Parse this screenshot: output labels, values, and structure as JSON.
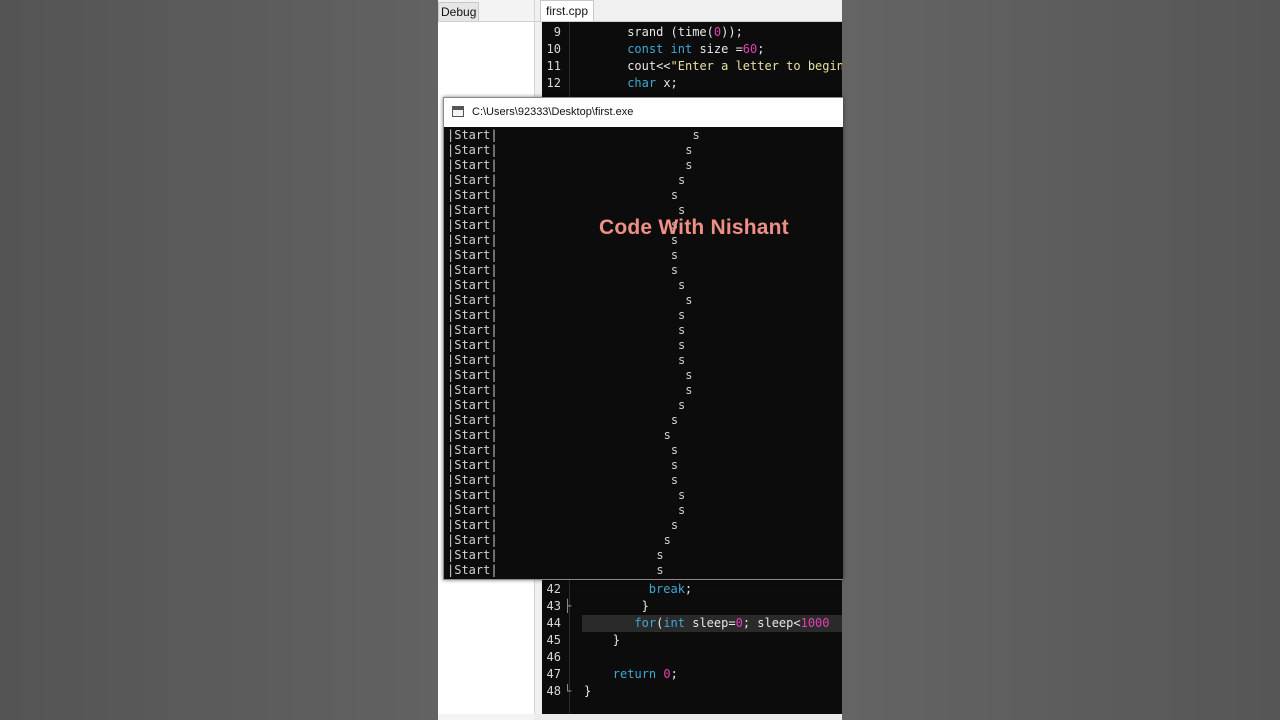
{
  "ide": {
    "panel_tab_label": "Debug",
    "file_tab_label": "first.cpp"
  },
  "editor": {
    "top_lines": [
      {
        "line": "9",
        "tokens": [
          [
            "",
            "srand (time("
          ],
          [
            "num",
            "0"
          ],
          [
            "",
            "));"
          ]
        ]
      },
      {
        "line": "10",
        "tokens": [
          [
            "kw",
            "const int"
          ],
          [
            "",
            " size ="
          ],
          [
            "num",
            "60"
          ],
          [
            "",
            ";"
          ]
        ]
      },
      {
        "line": "11",
        "tokens": [
          [
            "",
            "cout<<"
          ],
          [
            "str",
            "\"Enter a letter to begin"
          ]
        ]
      },
      {
        "line": "12",
        "tokens": [
          [
            "kw",
            "char"
          ],
          [
            "",
            " x;"
          ]
        ]
      }
    ],
    "bottom_lines": [
      {
        "line": "42",
        "tokens": [
          [
            "kw",
            "break"
          ],
          [
            "",
            ";"
          ]
        ]
      },
      {
        "line": "43",
        "tokens": [
          [
            "",
            "}"
          ]
        ]
      },
      {
        "line": "44",
        "tokens": [
          [
            "kw",
            "for"
          ],
          [
            "",
            "("
          ],
          [
            "kw",
            "int"
          ],
          [
            "",
            " sleep="
          ],
          [
            "num",
            "0"
          ],
          [
            "",
            "; sleep<"
          ],
          [
            "num",
            "1000"
          ]
        ]
      },
      {
        "line": "45",
        "tokens": [
          [
            "",
            "}"
          ]
        ]
      },
      {
        "line": "46",
        "tokens": []
      },
      {
        "line": "47",
        "tokens": [
          [
            "kw",
            "return"
          ],
          [
            "",
            " "
          ],
          [
            "num",
            "0"
          ],
          [
            "",
            ";"
          ]
        ]
      },
      {
        "line": "48",
        "tokens": [
          [
            "",
            "}"
          ]
        ]
      }
    ]
  },
  "console": {
    "title": "C:\\Users\\92333\\Desktop\\first.exe",
    "row_label": "|Start|",
    "marker": "s",
    "marker_columns": [
      34,
      33,
      33,
      32,
      31,
      32,
      31,
      31,
      31,
      31,
      32,
      33,
      32,
      32,
      32,
      32,
      33,
      33,
      32,
      31,
      30,
      31,
      31,
      31,
      32,
      32,
      31,
      30,
      29,
      29,
      29
    ]
  },
  "watermark": "Code With Nishant"
}
